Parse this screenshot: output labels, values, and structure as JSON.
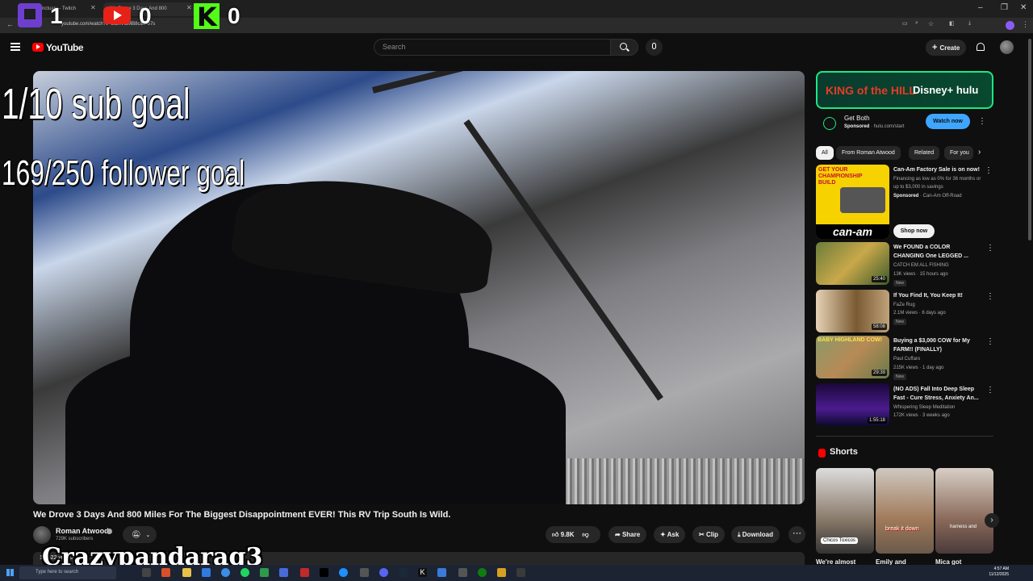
{
  "browser": {
    "tabs": [
      {
        "title": "yoursanctuary - Twitch"
      },
      {
        "title": "We Drove 3 Days And 800"
      }
    ],
    "url": "youtube.com/watch?v=5iEnViuMB8c&t=57s"
  },
  "counters": {
    "twitch": "1",
    "youtube": "0",
    "kick": "0"
  },
  "header": {
    "brand": "YouTube",
    "search_placeholder": "Search",
    "create_label": "Create"
  },
  "video": {
    "overlay_sub_goal": "1/10 sub goal",
    "overlay_follower_goal": "169/250 follower goal",
    "title": "We Drove 3 Days And 800 Miles For The Biggest Disappointment EVER! This RV Trip South Is Wild.",
    "channel": "Roman Atwood",
    "subscribers": "729K subscribers",
    "likes": "9.8K",
    "share": "Share",
    "ask": "Ask",
    "clip": "Clip",
    "download": "Download",
    "views": "14,622 views"
  },
  "watermark": "Crazypandarag3",
  "ad": {
    "banner_left": "KING of the HILL",
    "banner_right": "Disney+ hulu",
    "title": "Get Both",
    "sponsored": "Sponsored",
    "domain": "· hulu.com/start",
    "cta": "Watch now"
  },
  "chips": [
    "All",
    "From Roman Atwood",
    "Related",
    "For you"
  ],
  "sponsored_item": {
    "title": "Can-Am Factory Sale is on now!",
    "desc": "Financing as low as 0% for 36 months or up to $3,000 in savings",
    "sponsored": "Sponsored",
    "advertiser": "· Can-Am Off-Road",
    "cta": "Shop now",
    "thumb_top": "GET YOUR CHAMPIONSHIP BUILD",
    "thumb_brand": "can-am"
  },
  "related": [
    {
      "title": "We FOUND a COLOR CHANGING One LEGGED ...",
      "channel": "CATCH EM ALL FISHING",
      "meta": "13K views · 15 hours ago",
      "badge": "New",
      "duration": "25:40"
    },
    {
      "title": "If You Find It, You Keep It!",
      "channel": "FaZe Rug",
      "meta": "2.1M views · 6 days ago",
      "badge": "New",
      "duration": "58:08"
    },
    {
      "title": "Buying a $3,000 COW for My FARM!! (FINALLY)",
      "channel": "Paul Cuffaro",
      "meta": "215K views · 1 day ago",
      "badge": "New",
      "duration": "29:39",
      "thumb_text": "BABY HIGHLAND COW!"
    },
    {
      "title": "(NO ADS) Fall Into Deep Sleep Fast - Cure Stress, Anxiety An...",
      "channel": "Whispering Sleep Meditation",
      "meta": "172K views · 3 weeks ago",
      "duration": "1:55:18"
    }
  ],
  "shorts": {
    "title": "Shorts",
    "items": [
      {
        "label": "We're almost",
        "caption": "Chicos Toxicos"
      },
      {
        "label": "Emily and",
        "caption": "break it down"
      },
      {
        "label": "Mica got",
        "caption": "harness and"
      }
    ]
  },
  "taskbar": {
    "search_placeholder": "Type here to search",
    "time": "4:57 AM",
    "date": "11/12/2025"
  }
}
